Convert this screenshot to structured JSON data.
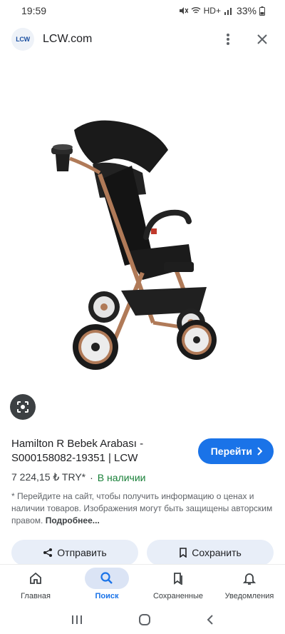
{
  "status": {
    "time": "19:59",
    "network": "HD+",
    "battery": "33%"
  },
  "header": {
    "logo_text": "LCW",
    "site": "LCW.com"
  },
  "product": {
    "title": "Hamilton R Bebek Arabası - S000158082-19351 | LCW",
    "goto_label": "Перейти",
    "price": "7 224,15 ₺ TRY*",
    "separator": "·",
    "stock": "В наличии",
    "disclaimer": "* Перейдите на сайт, чтобы получить информацию о ценах и наличии товаров. Изображения могут быть защищены авторским правом.",
    "more": "Подробнее..."
  },
  "actions": {
    "share_label": "Отправить",
    "save_label": "Сохранить"
  },
  "nav": {
    "items": [
      {
        "label": "Главная",
        "icon": "home-icon"
      },
      {
        "label": "Поиск",
        "icon": "search-icon"
      },
      {
        "label": "Сохраненные",
        "icon": "saved-icon"
      },
      {
        "label": "Уведомления",
        "icon": "bell-icon"
      }
    ],
    "active_index": 1
  },
  "colors": {
    "accent": "#1a73e8",
    "stock_green": "#188038",
    "action_bg": "#e8eef8",
    "stroller_frame": "#b07a58"
  }
}
